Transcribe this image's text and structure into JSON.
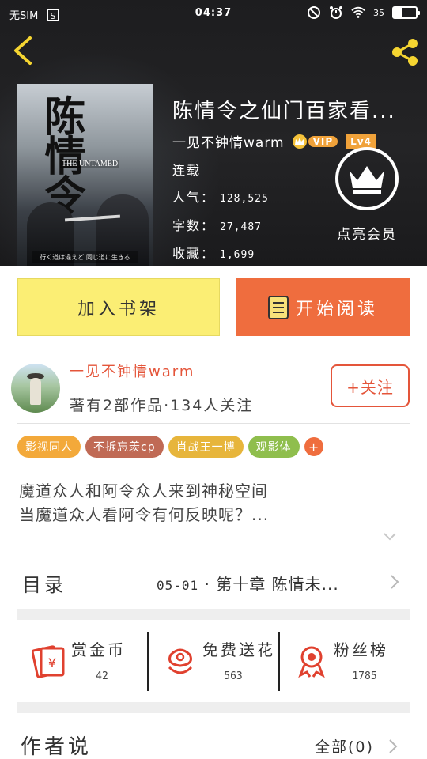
{
  "status_bar": {
    "carrier": "无SIM",
    "time": "04:37",
    "battery_text": "35"
  },
  "book": {
    "title": "陈情令之仙门百家看...",
    "author": "一见不钟情warm",
    "vip_label": "VIP",
    "level": "Lv4",
    "status": "连载",
    "popularity_label": "人气：",
    "popularity": "128,525",
    "wordcount_label": "字数：",
    "wordcount": "27,487",
    "favorites_label": "收藏：",
    "favorites": "1,699",
    "cover_title": "陈情令",
    "cover_subtitle": "THE UNTAMED",
    "cover_caption": "行く道は違えど 同じ道に生きる"
  },
  "member": {
    "label": "点亮会员"
  },
  "actions": {
    "add_shelf": "加入书架",
    "start_reading": "开始阅读"
  },
  "author_card": {
    "name": "一见不钟情warm",
    "stats": "著有2部作品·134人关注",
    "follow": "+关注"
  },
  "tags": [
    {
      "label": "影视同人",
      "color": "#f3a93a"
    },
    {
      "label": "不拆忘羡cp",
      "color": "#c06a55"
    },
    {
      "label": "肖战王一博",
      "color": "#e7b53b"
    },
    {
      "label": "观影体",
      "color": "#8fbe4d"
    }
  ],
  "tag_add": "+",
  "intro": {
    "line1": "魔道众人和阿令众人来到神秘空间",
    "line2": "当魔道众人看阿令有何反映呢？..."
  },
  "toc": {
    "label": "目录",
    "date": "05-01",
    "latest": "· 第十章  陈情未..."
  },
  "stats": [
    {
      "label": "赏金币",
      "value": "42",
      "icon": "red-envelope-icon"
    },
    {
      "label": "免费送花",
      "value": "563",
      "icon": "flower-icon"
    },
    {
      "label": "粉丝榜",
      "value": "1785",
      "icon": "medal-icon"
    }
  ],
  "author_words": {
    "label": "作者说",
    "all": "全部(0)"
  },
  "colors": {
    "accent_orange": "#ef6d3e",
    "accent_yellow": "#fbee74",
    "author_red": "#e4553a",
    "vip_gold": "#f0a23a"
  }
}
